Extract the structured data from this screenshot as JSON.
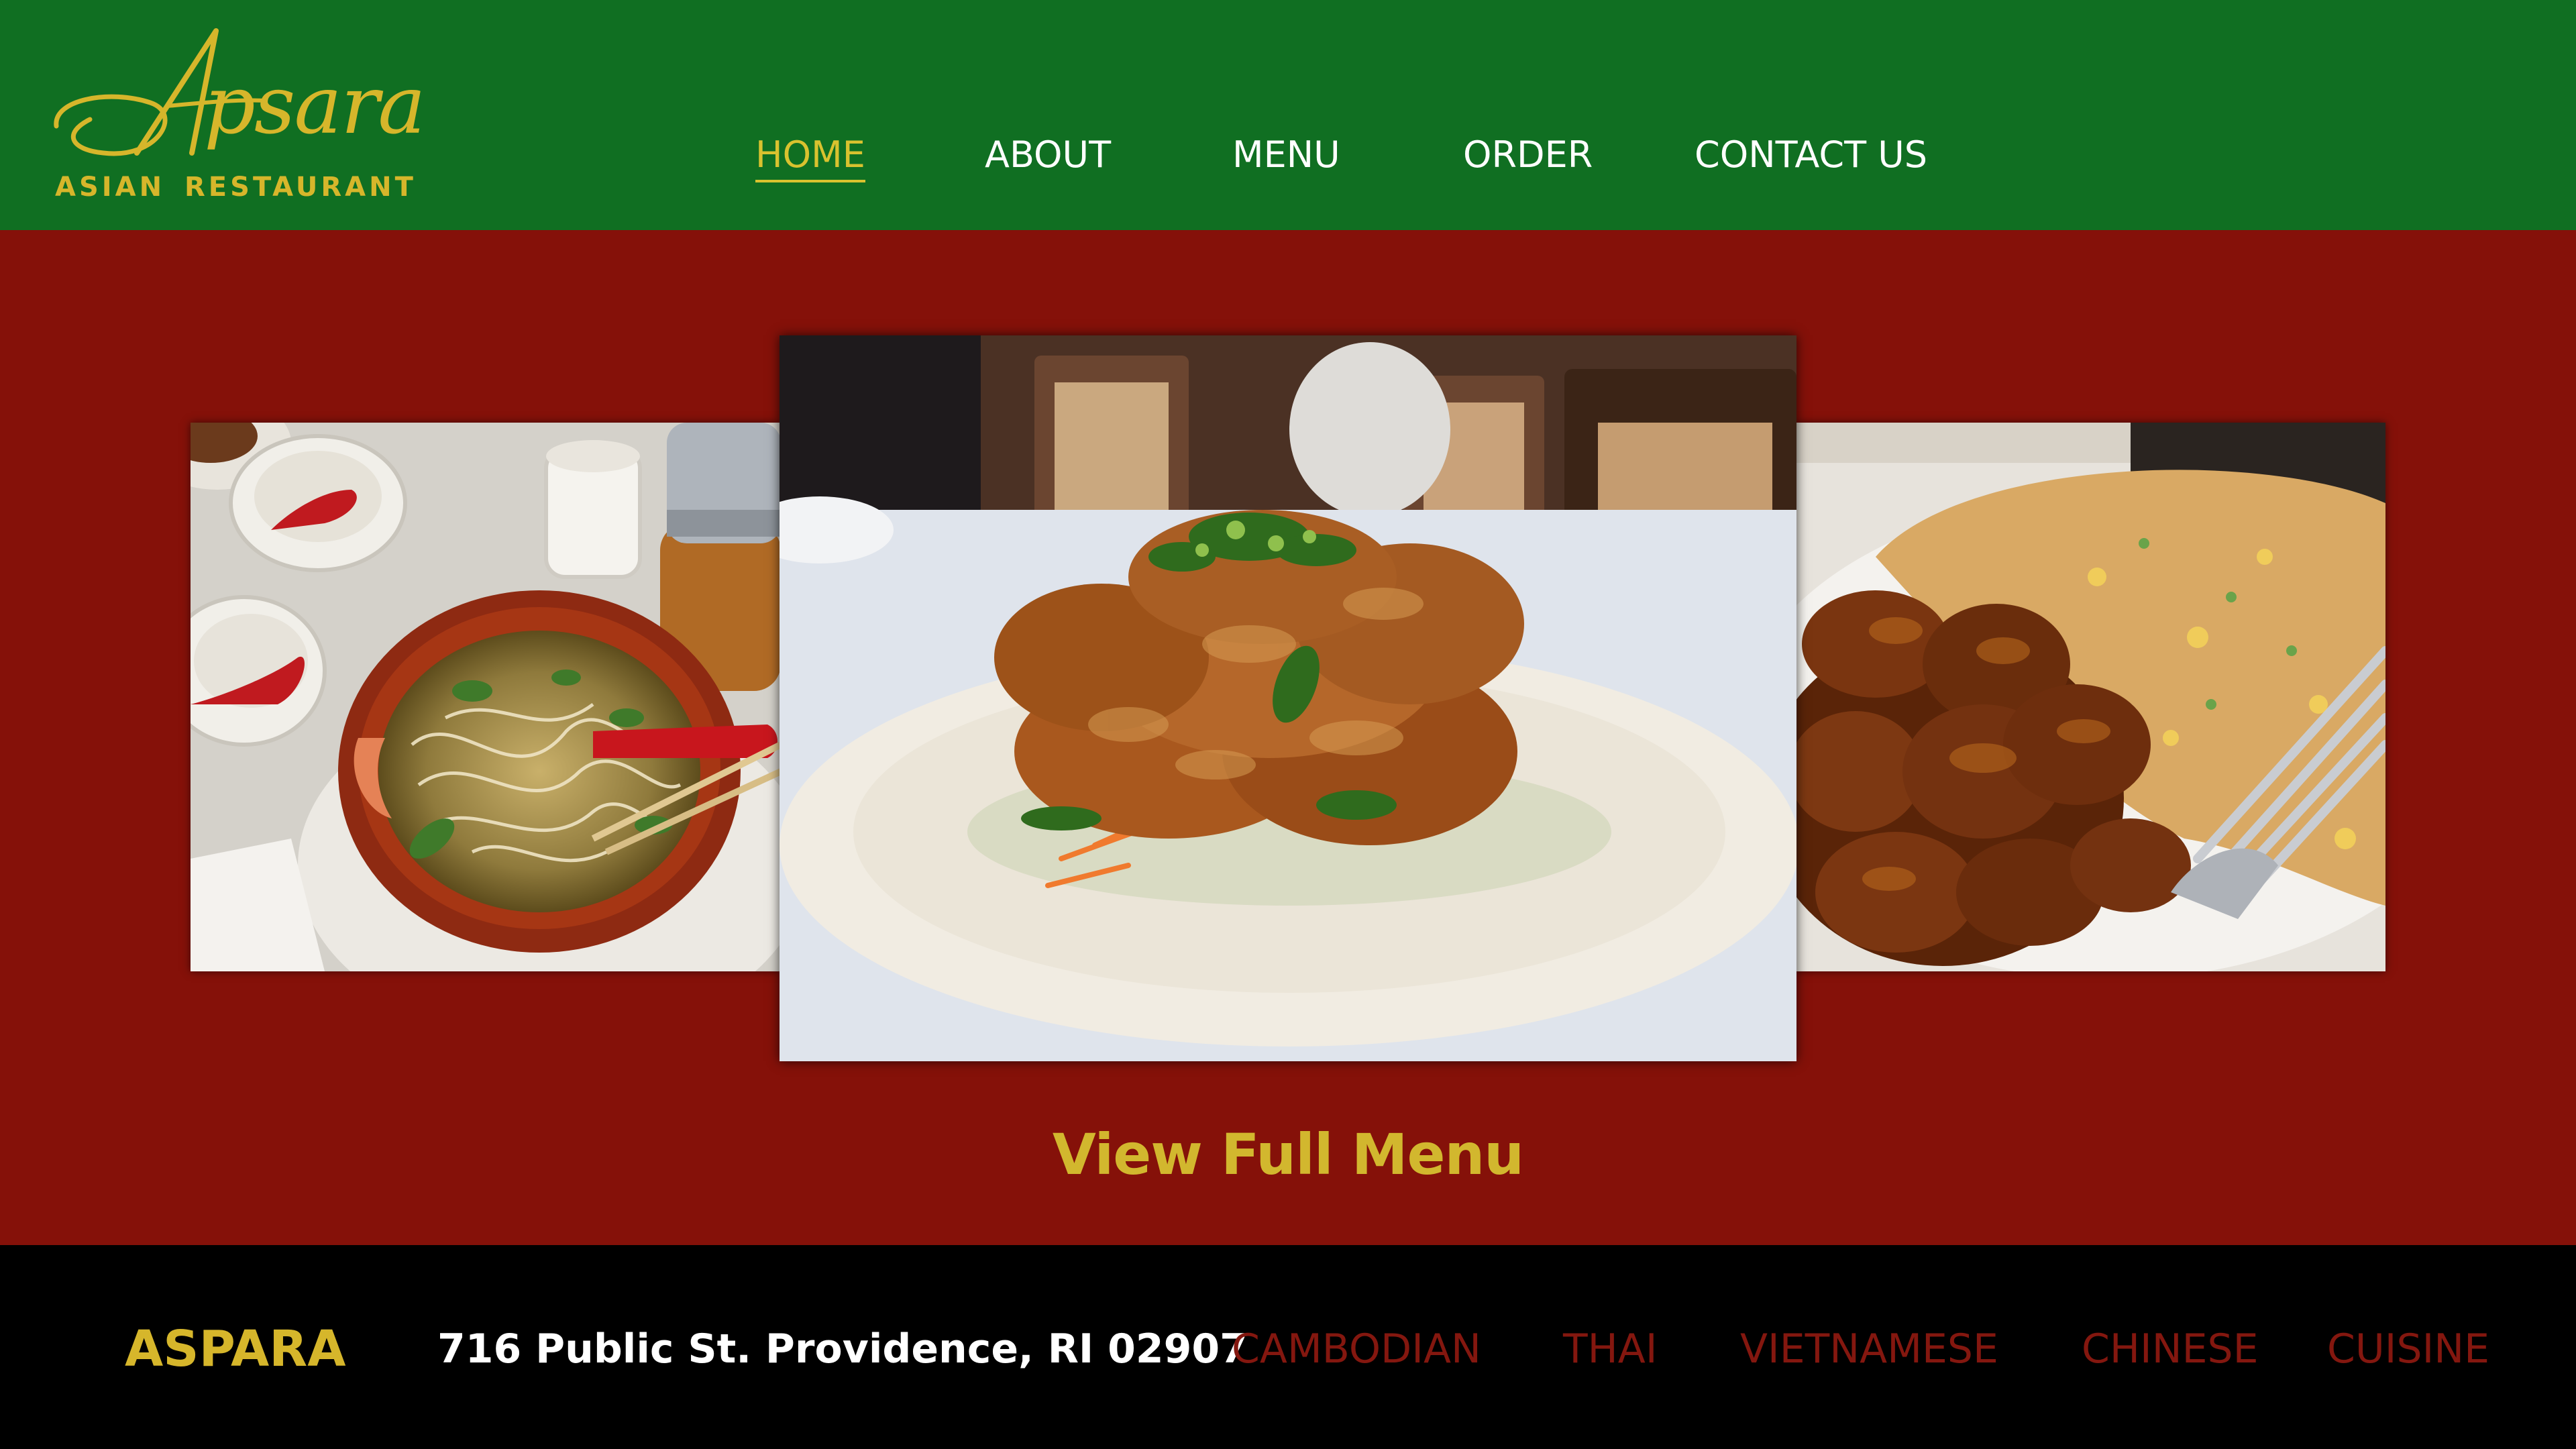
{
  "logo": {
    "script_text": "Apsara",
    "subtitle": "ASIAN  RESTAURANT"
  },
  "nav": {
    "items": [
      {
        "label": "HOME",
        "active": true
      },
      {
        "label": "ABOUT",
        "active": false
      },
      {
        "label": "MENU",
        "active": false
      },
      {
        "label": "ORDER",
        "active": false
      },
      {
        "label": "CONTACT US",
        "active": false
      }
    ]
  },
  "gallery": {
    "images": [
      "noodle-soup-photo",
      "fried-chicken-photo",
      "orange-chicken-fried-rice-photo"
    ]
  },
  "main": {
    "menu_link": "View Full Menu"
  },
  "footer": {
    "brand": "ASPARA",
    "address": "716 Public St. Providence, RI 02907",
    "cuisines": [
      "CAMBODIAN",
      "THAI",
      "VIETNAMESE",
      "CHINESE",
      "CUISINE"
    ]
  },
  "colors": {
    "header_green": "#106f22",
    "body_red": "#851109",
    "gold": "#d6b62b",
    "footer_black": "#000000",
    "cuisine_red": "#84170f"
  }
}
